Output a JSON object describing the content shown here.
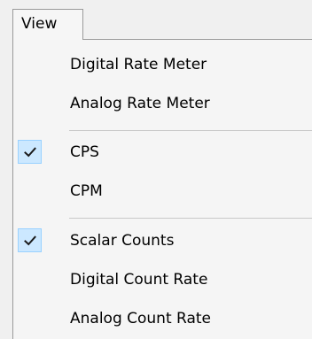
{
  "menu_title": "View",
  "groups": [
    {
      "items": [
        {
          "label": "Digital Rate Meter",
          "checked": false
        },
        {
          "label": "Analog Rate Meter",
          "checked": false
        }
      ]
    },
    {
      "items": [
        {
          "label": "CPS",
          "checked": true
        },
        {
          "label": "CPM",
          "checked": false
        }
      ]
    },
    {
      "items": [
        {
          "label": "Scalar Counts",
          "checked": true
        },
        {
          "label": "Digital Count Rate",
          "checked": false
        },
        {
          "label": "Analog Count Rate",
          "checked": false
        }
      ]
    }
  ],
  "colors": {
    "check_highlight": "#cce8ff",
    "check_border": "#99d1ff",
    "menu_background": "#f5f5f5"
  }
}
